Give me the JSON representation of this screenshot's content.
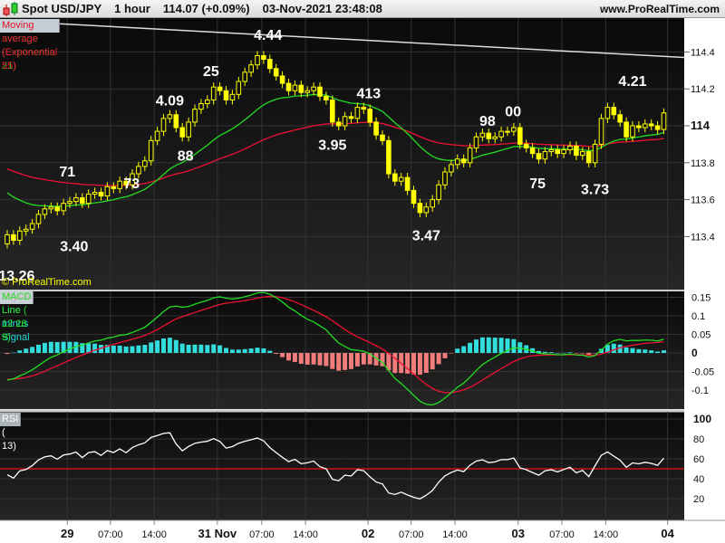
{
  "header": {
    "title": "Spot USD/JPY",
    "timeframe": "1 hour",
    "price": "114.07 (+0.09%)",
    "datetime": "03-Nov-2021 23:48:08",
    "site": "www.ProRealTime.com"
  },
  "legend_main": [
    {
      "label": "Price",
      "color": "#ffff00"
    },
    {
      "label": "Moving average (Exponential 21)",
      "color": "#22dd22"
    },
    {
      "label": "Moving average (Exponential 55)",
      "color": "#ee1133"
    }
  ],
  "legend_macd": [
    {
      "label": "MACD Line minus Signal",
      "color": "#22dddd"
    },
    {
      "label": "Signal",
      "color": "#ee1133"
    },
    {
      "label": "MACD Line ( 12 26 9)",
      "color": "#22dd22"
    }
  ],
  "legend_rsi": [
    {
      "label": "RSI ( 13)",
      "color": "#ffffff"
    }
  ],
  "watermark": "© ProRealTime.com",
  "chart_data": {
    "type": "candlestick",
    "open_first": 113.36,
    "wick": 0.025,
    "closes": [
      113.41,
      113.38,
      113.43,
      113.44,
      113.47,
      113.52,
      113.55,
      113.56,
      113.54,
      113.58,
      113.59,
      113.61,
      113.58,
      113.63,
      113.64,
      113.62,
      113.67,
      113.66,
      113.7,
      113.68,
      113.74,
      113.78,
      113.81,
      113.92,
      113.97,
      114.04,
      114.06,
      113.99,
      113.94,
      114.02,
      114.09,
      114.12,
      114.14,
      114.21,
      114.19,
      114.14,
      114.17,
      114.24,
      114.29,
      114.33,
      114.38,
      114.36,
      114.31,
      114.27,
      114.23,
      114.19,
      114.22,
      114.18,
      114.19,
      114.21,
      114.16,
      114.14,
      114.02,
      114.0,
      114.05,
      114.04,
      114.1,
      114.09,
      114.02,
      113.95,
      113.92,
      113.74,
      113.7,
      113.72,
      113.65,
      113.58,
      113.53,
      113.56,
      113.6,
      113.68,
      113.75,
      113.79,
      113.82,
      113.8,
      113.88,
      113.94,
      113.96,
      113.93,
      113.94,
      113.97,
      113.97,
      113.99,
      113.9,
      113.88,
      113.85,
      113.82,
      113.86,
      113.87,
      113.85,
      113.87,
      113.89,
      113.84,
      113.86,
      113.8,
      113.9,
      114.04,
      114.1,
      114.06,
      114.02,
      113.94,
      114.0,
      113.99,
      114.01,
      114.0,
      113.98,
      114.07
    ],
    "ema21_seed": 113.66,
    "ema55_seed": 113.78,
    "macd": {
      "fast": 12,
      "slow": 26,
      "signal": 9,
      "ema12_seed": 113.4,
      "ema26_seed": 113.48,
      "signal_seed": -0.07,
      "ticks": [
        "0.15",
        "0.1",
        "0.05",
        "0",
        "-0.05",
        "-0.1"
      ],
      "tick_values": [
        0.15,
        0.1,
        0.05,
        0,
        -0.05,
        -0.1
      ]
    },
    "rsi": {
      "period": 13,
      "seed_gain": 0.01,
      "seed_loss": 0.018,
      "ticks": [
        "100",
        "80",
        "60",
        "40",
        "20"
      ],
      "tick_values": [
        100,
        80,
        60,
        40,
        20
      ],
      "level": 50
    },
    "price_ticks": [
      "114.4",
      "114.2",
      "114",
      "113.8",
      "113.6",
      "113.4"
    ],
    "price_tick_values": [
      114.4,
      114.2,
      114,
      113.8,
      113.6,
      113.4
    ],
    "x_ticks": [
      {
        "label": "29",
        "i": 9.6,
        "bold": true
      },
      {
        "label": "07:00",
        "i": 16.5
      },
      {
        "label": "14:00",
        "i": 23.5
      },
      {
        "label": "31 Nov",
        "i": 33.6,
        "bold": true
      },
      {
        "label": "07:00",
        "i": 40.7
      },
      {
        "label": "14:00",
        "i": 47.7
      },
      {
        "label": "02",
        "i": 57.7,
        "bold": true
      },
      {
        "label": "07:00",
        "i": 64.6
      },
      {
        "label": "14:00",
        "i": 71.6
      },
      {
        "label": "03",
        "i": 81.7,
        "bold": true
      },
      {
        "label": "07:00",
        "i": 88.7
      },
      {
        "label": "14:00",
        "i": 95.7
      },
      {
        "label": "04",
        "i": 105.6,
        "bold": true
      }
    ],
    "trendline": [
      {
        "i": -1.2,
        "p": 114.57
      },
      {
        "i": 108.3,
        "p": 114.37
      }
    ],
    "annotations": [
      {
        "text": "13.26",
        "i": 1.5,
        "p": 113.19
      },
      {
        "text": "71",
        "i": 9.6,
        "p": 113.755
      },
      {
        "text": "3.40",
        "i": 10.7,
        "p": 113.35
      },
      {
        "text": "73",
        "i": 19.9,
        "p": 113.69
      },
      {
        "text": "4.09",
        "i": 26,
        "p": 114.14
      },
      {
        "text": "88",
        "i": 28.5,
        "p": 113.84
      },
      {
        "text": "25",
        "i": 32.6,
        "p": 114.3
      },
      {
        "text": "4.44",
        "i": 41.7,
        "p": 114.495
      },
      {
        "text": "3.95",
        "i": 52,
        "p": 113.9
      },
      {
        "text": "413",
        "i": 57.8,
        "p": 114.18
      },
      {
        "text": "3.47",
        "i": 67,
        "p": 113.41
      },
      {
        "text": "98",
        "i": 76.8,
        "p": 114.03
      },
      {
        "text": "00",
        "i": 80.9,
        "p": 114.08
      },
      {
        "text": "75",
        "i": 84.8,
        "p": 113.69
      },
      {
        "text": "3.73",
        "i": 94,
        "p": 113.66
      },
      {
        "text": "4.21",
        "i": 100,
        "p": 114.245
      }
    ]
  }
}
